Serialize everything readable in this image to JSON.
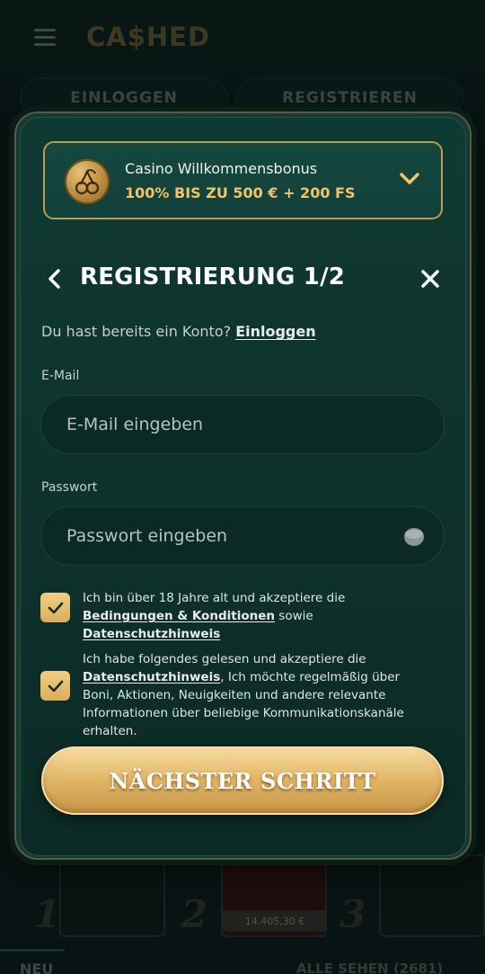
{
  "header": {
    "logo": "CA$HED",
    "tabs": [
      {
        "label": "EINLOGGEN"
      },
      {
        "label": "REGISTRIEREN"
      }
    ]
  },
  "background": {
    "card_numbers": [
      "1",
      "2",
      "3"
    ],
    "jackpot_amount": "14.405,30 €",
    "section_label": "NEU",
    "see_all": "ALLE SEHEN (2681)"
  },
  "bonus": {
    "title": "Casino Willkommensbonus",
    "offer": "100% BIS ZU 500 € + 200 FS",
    "icon": "cherry-icon"
  },
  "registration": {
    "title": "REGISTRIERUNG 1/2",
    "already_text": "Du hast bereits ein Konto?",
    "login_link": "Einloggen",
    "email": {
      "label": "E-Mail",
      "placeholder": "E-Mail eingeben",
      "value": ""
    },
    "password": {
      "label": "Passwort",
      "placeholder": "Passwort eingeben",
      "value": ""
    },
    "consent_age": {
      "checked": true,
      "text_1": "Ich bin über 18 Jahre alt und akzeptiere die",
      "link_terms": "Bedingungen & Konditionen",
      "text_2": "sowie",
      "link_privacy": "Datenschutzhinweis"
    },
    "consent_marketing": {
      "checked": true,
      "text_1": "Ich habe folgendes gelesen und akzeptiere die",
      "link_privacy": "Datenschutzhinweis",
      "text_2": ", Ich möchte regelmäßig über Boni, Aktionen, Neuigkeiten und andere relevante Informationen über beliebige Kommunikationskanäle erhalten."
    },
    "next_button": "NÄCHSTER SCHRITT"
  },
  "colors": {
    "accent_gold": "#e3b86a",
    "offer_gold": "#f1c36a",
    "panel_green": "#0f3a32"
  }
}
